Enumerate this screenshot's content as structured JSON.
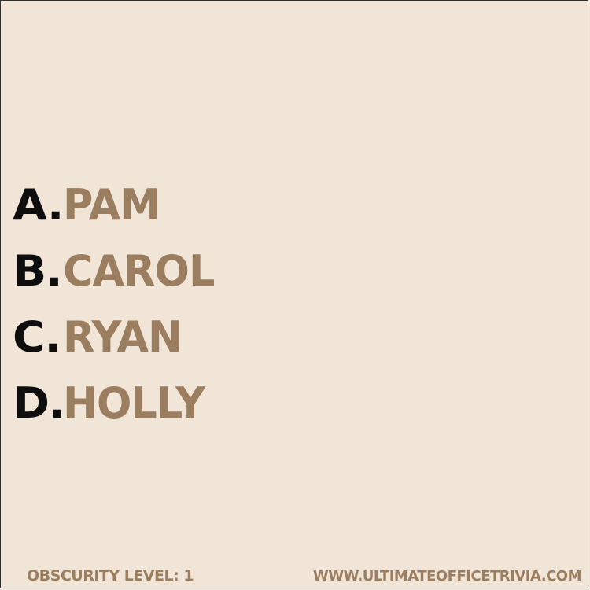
{
  "colors": {
    "background": "#f1e5d7",
    "letter": "#0f0e0e",
    "answer": "#9b7d5f"
  },
  "answers": [
    {
      "letter": "A.",
      "text": "PAM"
    },
    {
      "letter": "B.",
      "text": "CAROL"
    },
    {
      "letter": "C.",
      "text": "RYAN"
    },
    {
      "letter": "D.",
      "text": "HOLLY"
    }
  ],
  "footer": {
    "obscurity": "OBSCURITY LEVEL: 1",
    "website": "WWW.ULTIMATEOFFICETRIVIA.COM"
  }
}
